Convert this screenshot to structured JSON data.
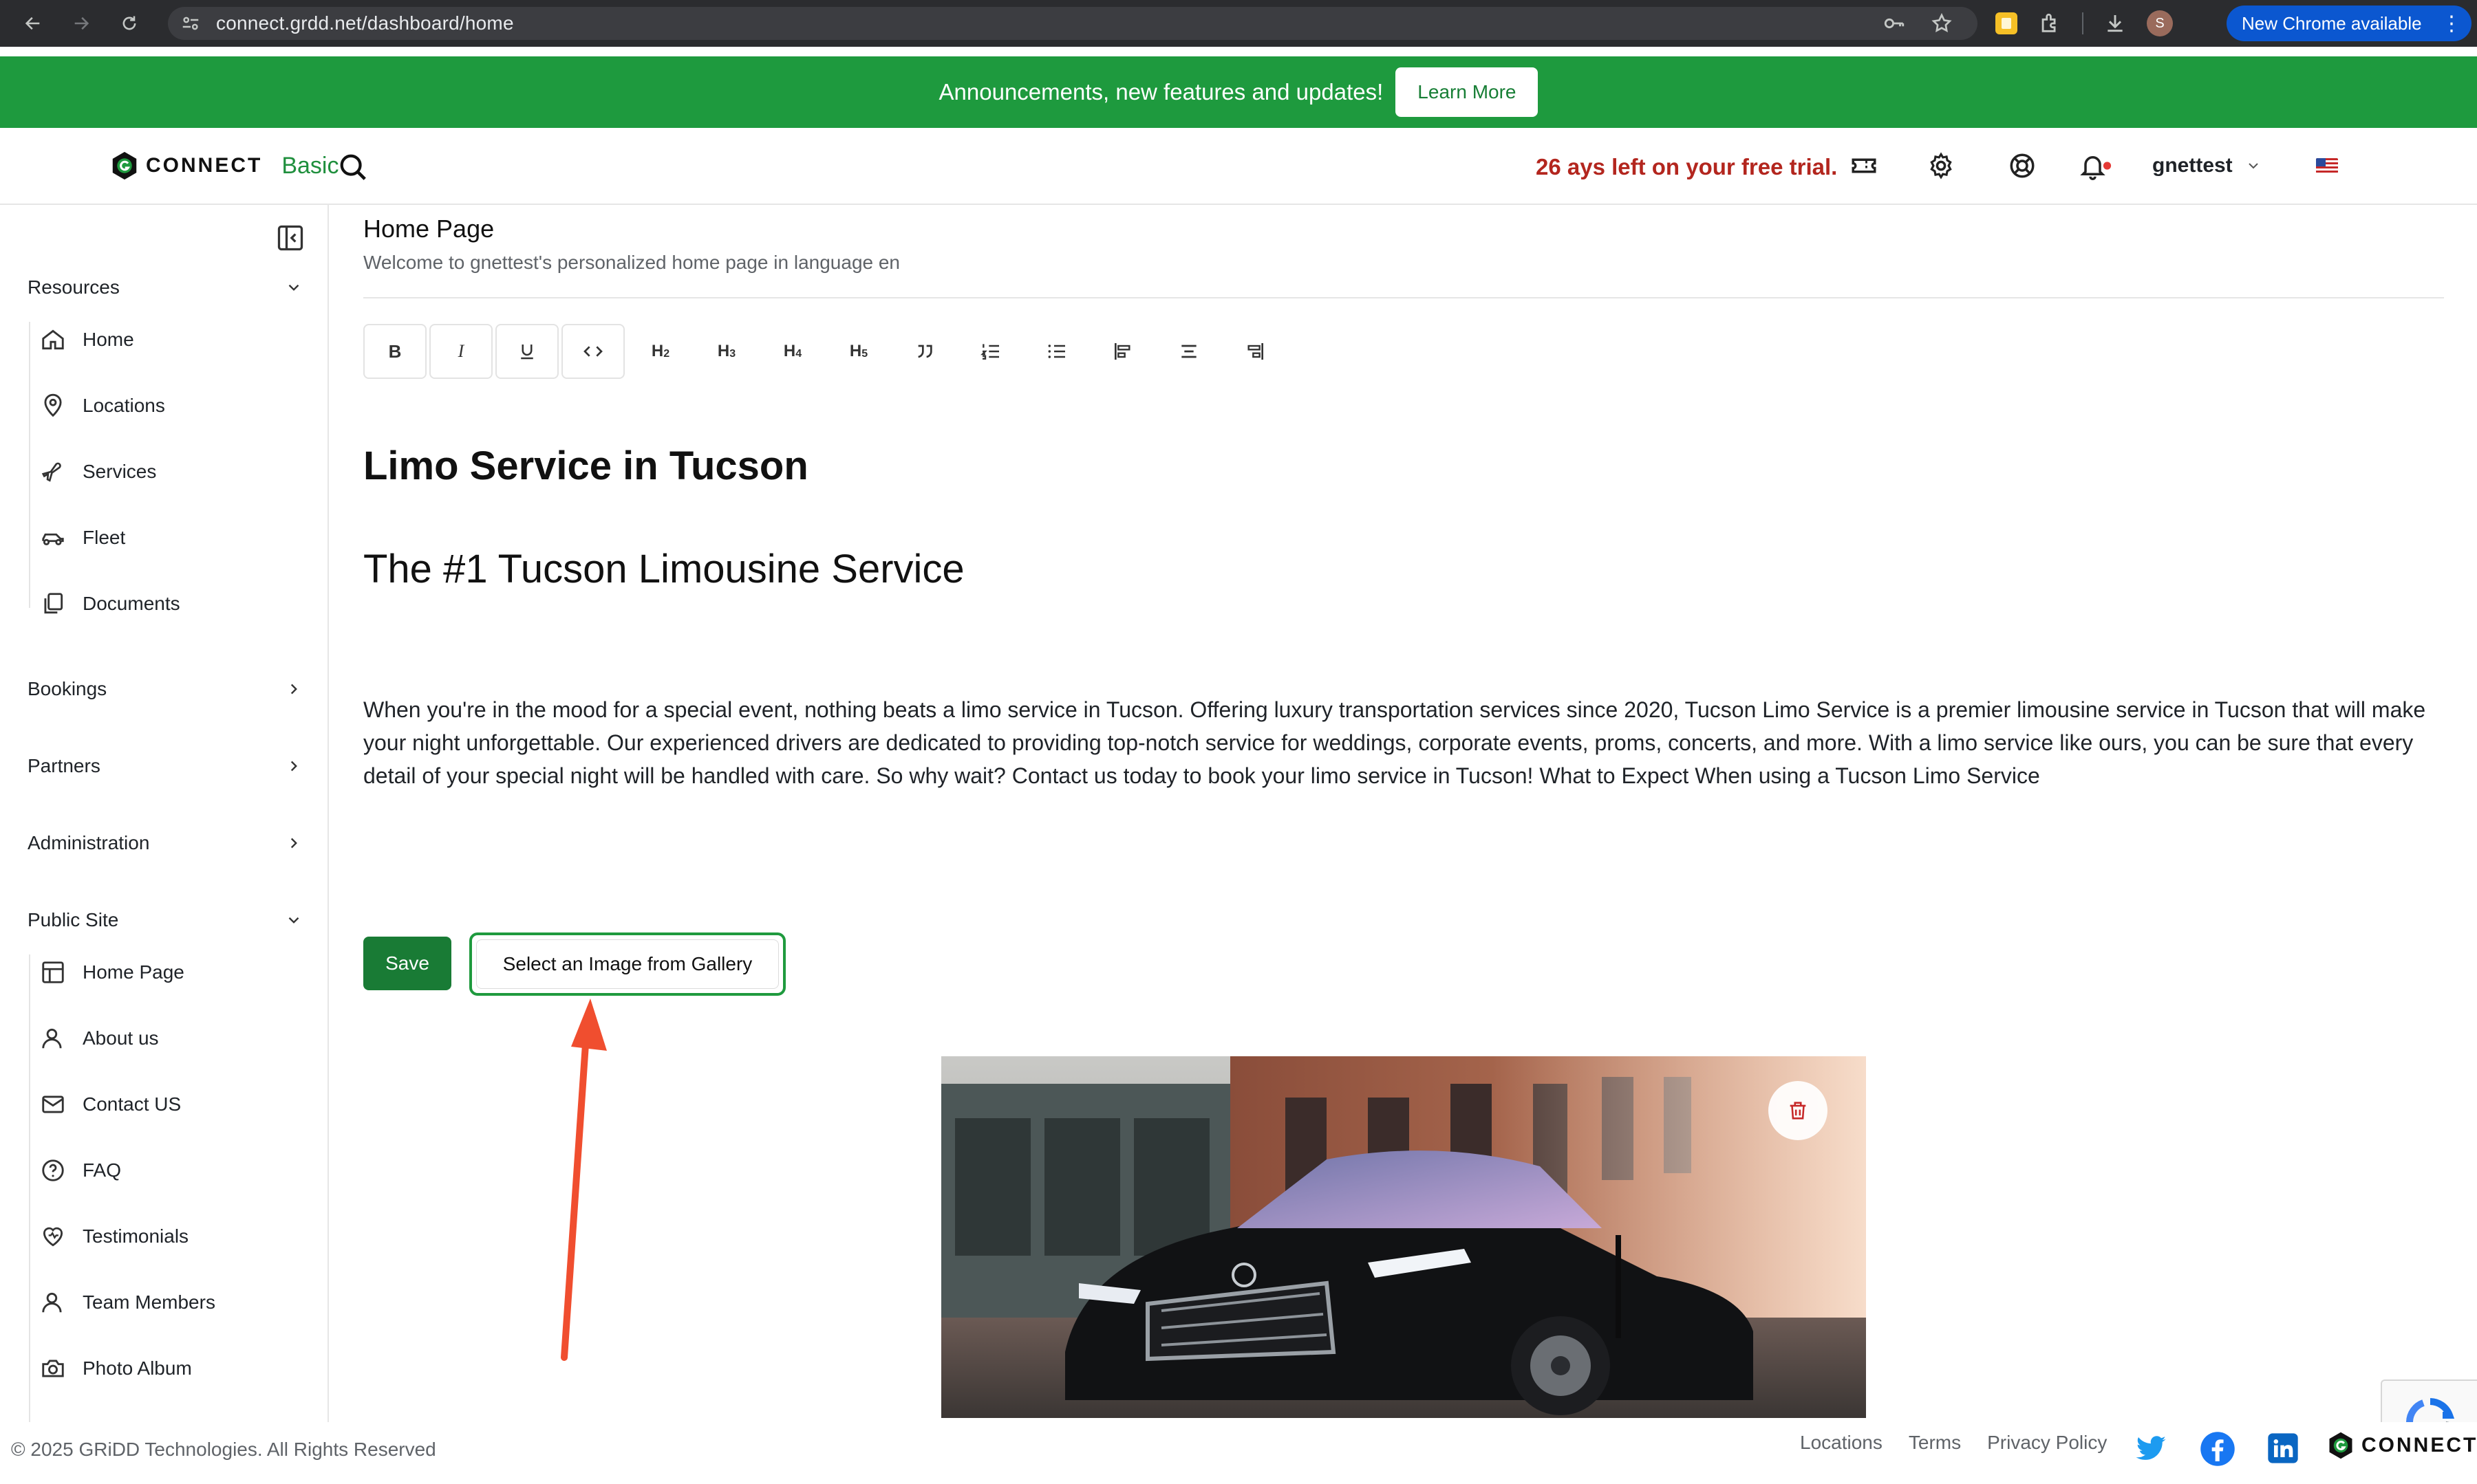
{
  "browser": {
    "url": "connect.grdd.net/dashboard/home",
    "new_chrome_label": "New Chrome available",
    "profile_initial": "S"
  },
  "announcement": {
    "message": "Announcements, new features and updates!",
    "learn_more": "Learn More"
  },
  "header": {
    "logo_text": "CONNECT",
    "tier": "Basic",
    "trial_notice": "26 ays left on your free trial.",
    "username": "gnettest"
  },
  "sidebar": {
    "resources": {
      "label": "Resources",
      "items": [
        {
          "label": "Home",
          "icon": "home-icon"
        },
        {
          "label": "Locations",
          "icon": "location-pin-icon"
        },
        {
          "label": "Services",
          "icon": "airplane-icon"
        },
        {
          "label": "Fleet",
          "icon": "car-icon"
        },
        {
          "label": "Documents",
          "icon": "documents-icon"
        }
      ]
    },
    "bookings": {
      "label": "Bookings"
    },
    "partners": {
      "label": "Partners"
    },
    "administration": {
      "label": "Administration"
    },
    "public_site": {
      "label": "Public Site",
      "items": [
        {
          "label": "Home Page",
          "icon": "layout-icon"
        },
        {
          "label": "About us",
          "icon": "user-icon"
        },
        {
          "label": "Contact US",
          "icon": "mail-icon"
        },
        {
          "label": "FAQ",
          "icon": "question-icon"
        },
        {
          "label": "Testimonials",
          "icon": "heart-icon"
        },
        {
          "label": "Team Members",
          "icon": "user-icon"
        },
        {
          "label": "Photo Album",
          "icon": "camera-icon"
        }
      ]
    }
  },
  "main": {
    "title": "Home Page",
    "subtitle": "Welcome to gnettest's personalized home page in language en",
    "toolbar": {
      "bold": "B",
      "italic": "I",
      "h2": "H",
      "h2_sub": "2",
      "h3": "H",
      "h3_sub": "3",
      "h4": "H",
      "h4_sub": "4",
      "h5": "H",
      "h5_sub": "5"
    },
    "heading1": "Limo Service in Tucson",
    "heading2": "The #1 Tucson Limousine Service",
    "paragraph": "When you're in the mood for a special event, nothing beats a limo service in Tucson. Offering luxury transportation services since 2020, Tucson Limo Service is a premier limousine service in Tucson that will make your night unforgettable. Our experienced drivers are dedicated to providing top-notch service for weddings, corporate events, proms, concerts, and more. With a limo service like ours, you can be sure that every detail of your special night will be handled with care. So why wait? Contact us today to book your limo service in Tucson! What to Expect When using a Tucson Limo Service",
    "save_label": "Save",
    "gallery_label": "Select an Image from Gallery"
  },
  "footer": {
    "copyright": "© 2025 GRiDD Technologies. All Rights Reserved",
    "links": [
      "Locations",
      "Terms",
      "Privacy Policy"
    ],
    "logo_text": "CONNECT"
  },
  "colors": {
    "brand_green": "#1e9a3e",
    "trial_red": "#b3261e",
    "annotation_arrow": "#f04e2f"
  }
}
